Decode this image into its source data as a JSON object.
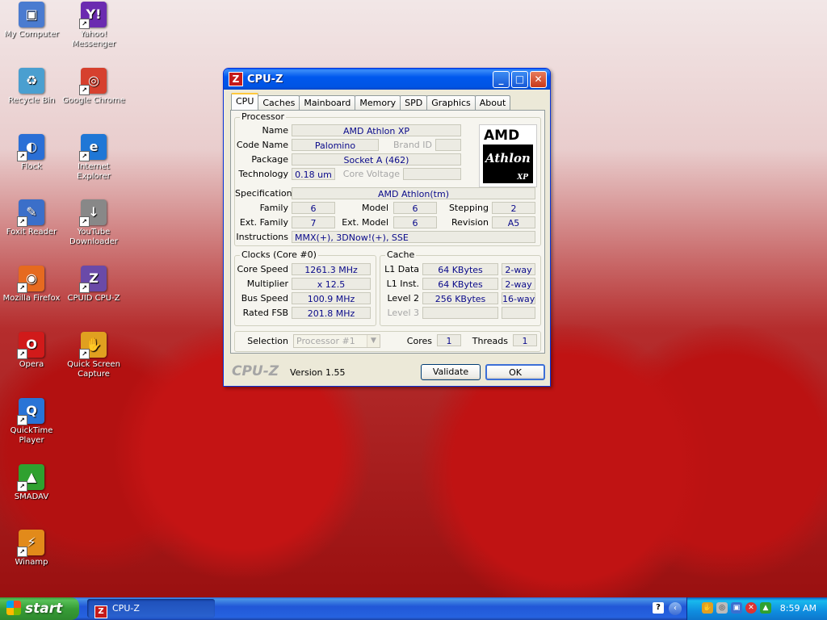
{
  "desktop": {
    "icons": [
      {
        "label": "My Computer",
        "icon": "computer-icon",
        "color": "#4a7bd0",
        "glyph": "▣"
      },
      {
        "label": "Recycle Bin",
        "icon": "recycle-bin-icon",
        "color": "#4a9fd0",
        "glyph": "♻"
      },
      {
        "label": "Flock",
        "icon": "flock-icon",
        "color": "#2a6fd6",
        "glyph": "◐"
      },
      {
        "label": "Foxit Reader",
        "icon": "foxit-reader-icon",
        "color": "#3b6fc9",
        "glyph": "✎"
      },
      {
        "label": "Mozilla Firefox",
        "icon": "firefox-icon",
        "color": "#e66a1f",
        "glyph": "◉"
      },
      {
        "label": "Opera",
        "icon": "opera-icon",
        "color": "#d11a1a",
        "glyph": "O"
      },
      {
        "label": "QuickTime Player",
        "icon": "quicktime-icon",
        "color": "#2a74d6",
        "glyph": "Q"
      },
      {
        "label": "SMADAV",
        "icon": "smadav-icon",
        "color": "#2fa12f",
        "glyph": "▲"
      },
      {
        "label": "Winamp",
        "icon": "winamp-icon",
        "color": "#e28a1a",
        "glyph": "⚡"
      },
      {
        "label": "Yahoo! Messenger",
        "icon": "yahoo-messenger-icon",
        "color": "#6b2bb0",
        "glyph": "Y!"
      },
      {
        "label": "Google Chrome",
        "icon": "chrome-icon",
        "color": "#d6402e",
        "glyph": "◎"
      },
      {
        "label": "Internet Explorer",
        "icon": "internet-explorer-icon",
        "color": "#1f77d6",
        "glyph": "e"
      },
      {
        "label": "YouTube Downloader",
        "icon": "youtube-downloader-icon",
        "color": "#888888",
        "glyph": "↓"
      },
      {
        "label": "CPUID CPU-Z",
        "icon": "cpuz-icon",
        "color": "#6a4aa8",
        "glyph": "Z"
      },
      {
        "label": "Quick Screen Capture",
        "icon": "screen-capture-icon",
        "color": "#e0a020",
        "glyph": "✋"
      }
    ]
  },
  "window": {
    "title": "CPU-Z",
    "tabs": [
      "CPU",
      "Caches",
      "Mainboard",
      "Memory",
      "SPD",
      "Graphics",
      "About"
    ],
    "processor": {
      "group_title": "Processor",
      "name_label": "Name",
      "name": "AMD Athlon XP",
      "codename_label": "Code Name",
      "codename": "Palomino",
      "brandid_label": "Brand ID",
      "brandid": "",
      "package_label": "Package",
      "package": "Socket A (462)",
      "technology_label": "Technology",
      "technology": "0.18 um",
      "corevoltage_label": "Core Voltage",
      "corevoltage": "",
      "specification_label": "Specification",
      "specification": "AMD Athlon(tm)",
      "family_label": "Family",
      "family": "6",
      "model_label": "Model",
      "model": "6",
      "stepping_label": "Stepping",
      "stepping": "2",
      "extfamily_label": "Ext. Family",
      "extfamily": "7",
      "extmodel_label": "Ext. Model",
      "extmodel": "6",
      "revision_label": "Revision",
      "revision": "A5",
      "instructions_label": "Instructions",
      "instructions": "MMX(+), 3DNow!(+), SSE",
      "logo_brand": "AMD",
      "logo_line1": "Athlon",
      "logo_line2": "XP"
    },
    "clocks": {
      "group_title": "Clocks (Core #0)",
      "corespeed_label": "Core Speed",
      "corespeed": "1261.3 MHz",
      "multiplier_label": "Multiplier",
      "multiplier": "x 12.5",
      "busspeed_label": "Bus Speed",
      "busspeed": "100.9 MHz",
      "ratedfsb_label": "Rated FSB",
      "ratedfsb": "201.8 MHz"
    },
    "cache": {
      "group_title": "Cache",
      "l1data_label": "L1 Data",
      "l1data": "64 KBytes",
      "l1data_way": "2-way",
      "l1inst_label": "L1 Inst.",
      "l1inst": "64 KBytes",
      "l1inst_way": "2-way",
      "level2_label": "Level 2",
      "level2": "256 KBytes",
      "level2_way": "16-way",
      "level3_label": "Level 3",
      "level3": "",
      "level3_way": ""
    },
    "selection": {
      "label": "Selection",
      "value": "Processor #1",
      "cores_label": "Cores",
      "cores": "1",
      "threads_label": "Threads",
      "threads": "1"
    },
    "footer": {
      "brand": "CPU-Z",
      "version": "Version 1.55",
      "validate": "Validate",
      "ok": "OK"
    }
  },
  "taskbar": {
    "start": "start",
    "task_label": "CPU-Z",
    "clock": "8:59 AM"
  }
}
